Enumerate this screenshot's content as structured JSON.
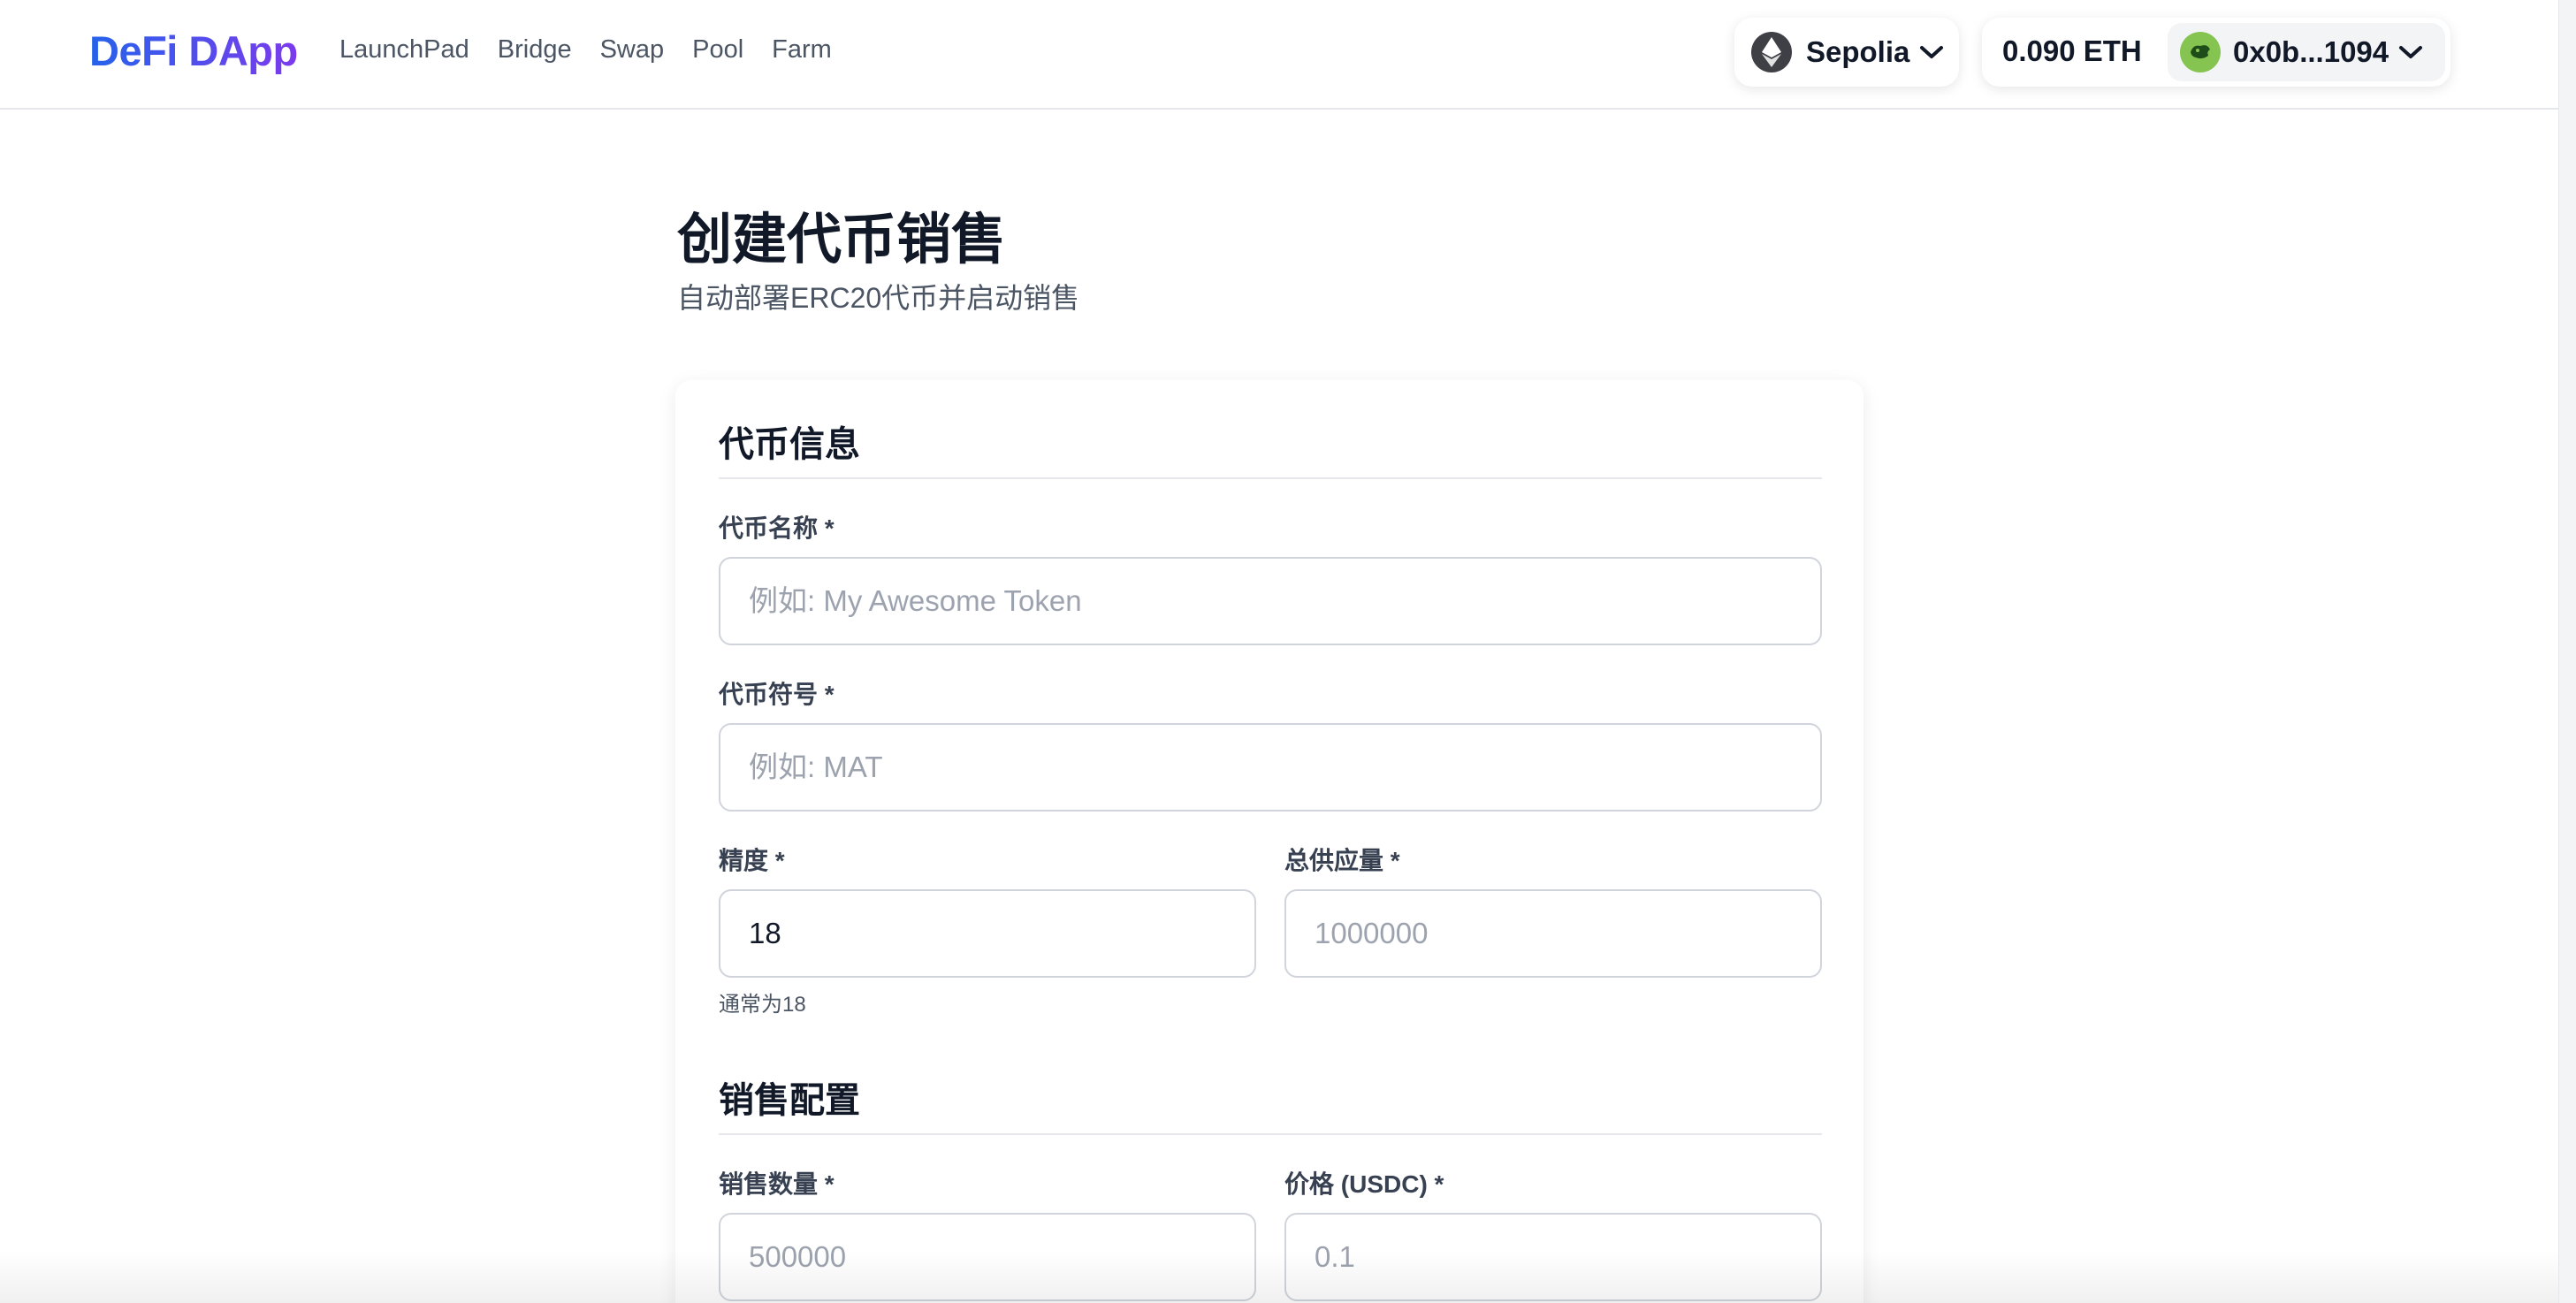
{
  "header": {
    "logo": "DeFi DApp",
    "nav": [
      "LaunchPad",
      "Bridge",
      "Swap",
      "Pool",
      "Farm"
    ],
    "network": "Sepolia",
    "balance": "0.090 ETH",
    "address": "0x0b...1094"
  },
  "page": {
    "title": "创建代币销售",
    "subtitle": "自动部署ERC20代币并启动销售"
  },
  "token_info": {
    "section_title": "代币信息",
    "name_label": "代币名称 *",
    "name_placeholder": "例如: My Awesome Token",
    "symbol_label": "代币符号 *",
    "symbol_placeholder": "例如: MAT",
    "decimals_label": "精度 *",
    "decimals_value": "18",
    "decimals_hint": "通常为18",
    "supply_label": "总供应量 *",
    "supply_placeholder": "1000000"
  },
  "sale_config": {
    "section_title": "销售配置",
    "amount_label": "销售数量 *",
    "amount_placeholder": "500000",
    "price_label": "价格 (USDC) *",
    "price_placeholder": "0.1"
  },
  "colors": {
    "accent_start": "#2563eb",
    "accent_end": "#7c3aed",
    "avatar": "#86c451"
  }
}
